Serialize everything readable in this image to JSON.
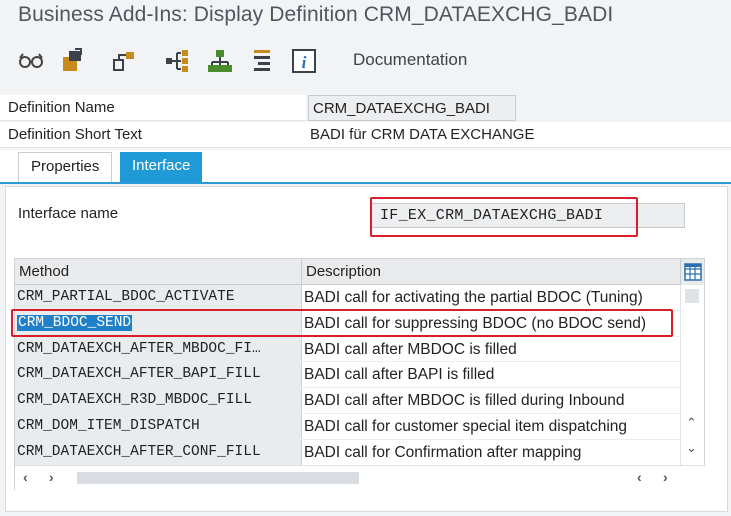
{
  "window": {
    "title": "Business Add-Ins: Display Definition CRM_DATAEXCHG_BADI"
  },
  "toolbar": {
    "icons": [
      "glasses-icon",
      "object-transport-icon",
      "hierarchy-icon",
      "interface-nav-icon",
      "tree-structure-icon",
      "list-icon",
      "info-icon"
    ],
    "documentation_label": "Documentation"
  },
  "definition": {
    "name_label": "Definition Name",
    "name_value": "CRM_DATAEXCHG_BADI",
    "short_text_label": "Definition Short Text",
    "short_text_value": "BADI  für  CRM DATA EXCHANGE"
  },
  "tabs": [
    {
      "label": "Properties",
      "active": false
    },
    {
      "label": "Interface",
      "active": true
    }
  ],
  "interface": {
    "name_label": "Interface name",
    "name_value": "IF_EX_CRM_DATAEXCHG_BADI"
  },
  "methods_table": {
    "columns": [
      "Method",
      "Description"
    ],
    "rows": [
      {
        "method": "CRM_PARTIAL_BDOC_ACTIVATE",
        "description": "BADI call for activating the partial BDOC (Tuning)"
      },
      {
        "method": "CRM_BDOC_SEND",
        "description": "BADI call for suppressing BDOC (no BDOC send)",
        "selected": true
      },
      {
        "method": "CRM_DATAEXCH_AFTER_MBDOC_FI…",
        "description": "BADI call  after MBDOC is filled"
      },
      {
        "method": "CRM_DATAEXCH_AFTER_BAPI_FILL",
        "description": "BADI call  after BAPI  is filled"
      },
      {
        "method": "CRM_DATAEXCH_R3D_MBDOC_FILL",
        "description": "BADI call  after MBDOC is filled during Inbound"
      },
      {
        "method": "CRM_DOM_ITEM_DISPATCH",
        "description": "BADI call for customer special item dispatching"
      },
      {
        "method": "CRM_DATAEXCH_AFTER_CONF_FILL",
        "description": "BADI call for Confirmation after  mapping"
      }
    ]
  },
  "colors": {
    "accent": "#1f9ad7",
    "highlight": "#d81e28",
    "selection": "#1f80c9"
  }
}
